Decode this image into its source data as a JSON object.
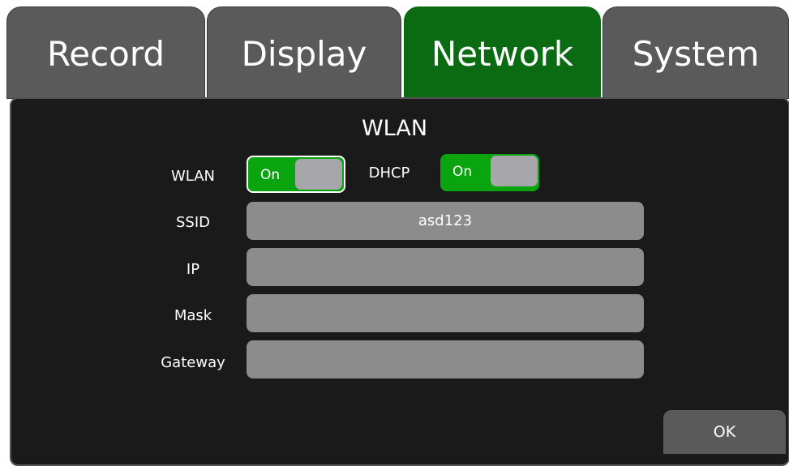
{
  "tabs": [
    {
      "label": "Record"
    },
    {
      "label": "Display"
    },
    {
      "label": "Network"
    },
    {
      "label": "System"
    }
  ],
  "active_tab": "Network",
  "colors": {
    "active_tab": "#0b6b12",
    "tab": "#5a5a5a",
    "panel_bg": "#1a1a1a",
    "toggle_on": "#0aa40f",
    "field_bg": "#8c8c8c"
  },
  "panel": {
    "title": "WLAN"
  },
  "wlan": {
    "label": "WLAN",
    "state": "On"
  },
  "dhcp": {
    "label": "DHCP",
    "state": "On"
  },
  "fields": {
    "ssid": {
      "label": "SSID",
      "value": "asd123"
    },
    "ip": {
      "label": "IP",
      "value": ""
    },
    "mask": {
      "label": "Mask",
      "value": ""
    },
    "gateway": {
      "label": "Gateway",
      "value": ""
    }
  },
  "ok_label": "OK"
}
